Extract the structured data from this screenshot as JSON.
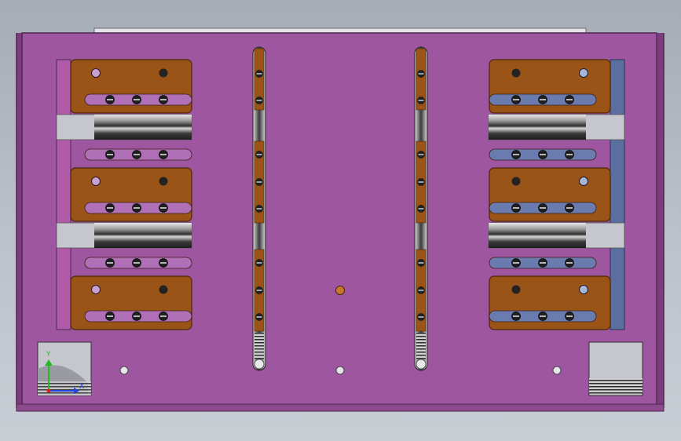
{
  "viewport": {
    "background": "#b6bcc5",
    "type": "cad-model-view"
  },
  "colors": {
    "plate": "#9e56a0",
    "plate_edge": "#4e2550",
    "plate_shadow": "#7c3d7e",
    "bracket": "#9b5418",
    "bracket_edge": "#4a2608",
    "rail_dark": "#2e2e2e",
    "rail_light": "#c8c8c8",
    "slot_dark": "#303030",
    "hole": "#2a2a2a",
    "rod_strip": "#8b4d9e",
    "rod_strip_right": "#5a6ea0",
    "block": "#a8a8b0"
  },
  "triad": {
    "y_label": "Y",
    "x_label": "X",
    "y_color": "#22bb22",
    "x_color": "#2244dd",
    "z_color": "#dd2222"
  }
}
